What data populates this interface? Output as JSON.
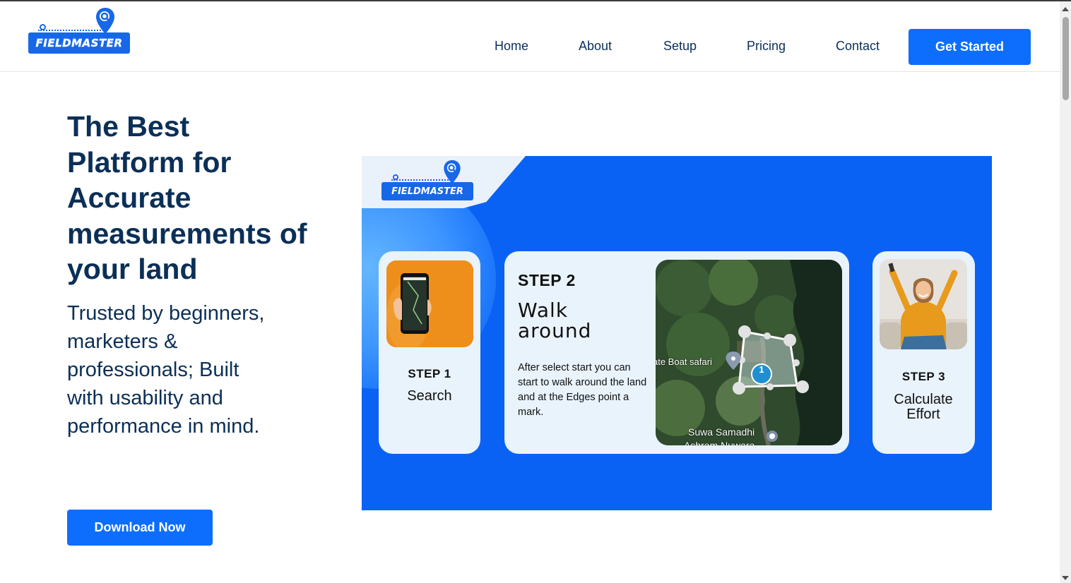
{
  "header": {
    "logo_text": "FIELDMASTER",
    "nav": [
      {
        "label": "Home"
      },
      {
        "label": "About"
      },
      {
        "label": "Setup"
      },
      {
        "label": "Pricing"
      },
      {
        "label": "Contact"
      }
    ],
    "cta_label": "Get Started"
  },
  "hero": {
    "title": "The Best Platform for Accurate measurements of your land",
    "subtitle": "Trusted by beginners, marketers & professionals; Built with usability and performance in mind.",
    "download_label": "Download Now"
  },
  "banner": {
    "logo_text": "FIELDMASTER",
    "steps": [
      {
        "number": "STEP 1",
        "name": "Search"
      },
      {
        "number": "STEP 2",
        "name": "Walk around",
        "description": "After select start you can start to walk around the land and at the Edges point a mark."
      },
      {
        "number": "STEP 3",
        "name": "Calculate Effort"
      }
    ],
    "map": {
      "label_boat": "ate Boat safari",
      "label_place": "Suwa Samadhi",
      "label_place2": "Ashram Nuwara",
      "marker_count": "1"
    }
  },
  "colors": {
    "primary": "#0d6efd",
    "navy": "#0b2f57",
    "banner_blue": "#0a62f5",
    "card_bg": "#e9f3fc"
  }
}
